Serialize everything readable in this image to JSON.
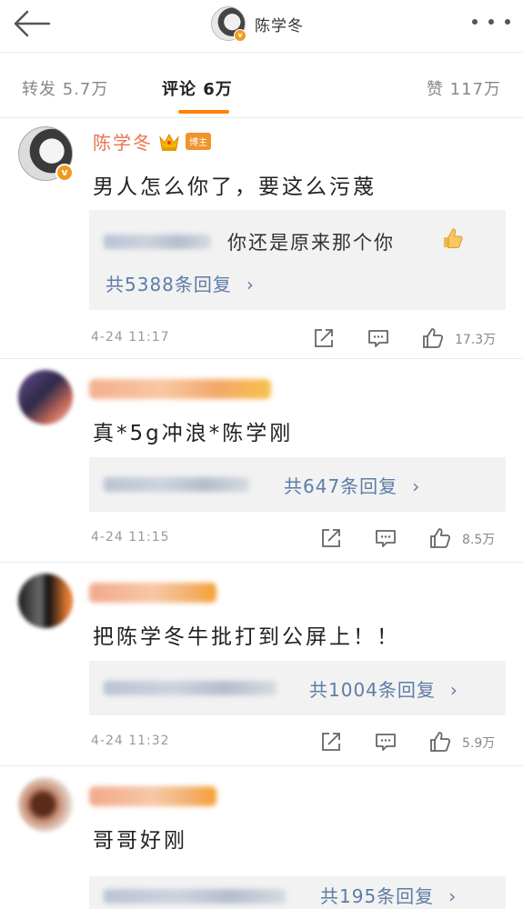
{
  "header": {
    "name": "陈学冬"
  },
  "tabs": {
    "forward": "转发 5.7万",
    "comments": "评论 6万",
    "likes": "赞 117万"
  },
  "comments": [
    {
      "author": "陈学冬",
      "badge": "博主",
      "text": "男人怎么你了，要这么污蔑",
      "reply_preview": "你还是原来那个你",
      "reply_count": "共5388条回复",
      "time": "4-24 11:17",
      "likes": "17.3万"
    },
    {
      "text": "真*5g冲浪*陈学刚",
      "reply_count": "共647条回复",
      "time": "4-24 11:15",
      "likes": "8.5万"
    },
    {
      "text": "把陈学冬牛批打到公屏上！！",
      "reply_count": "共1004条回复",
      "time": "4-24 11:32",
      "likes": "5.9万"
    },
    {
      "text": "哥哥好刚",
      "reply_count": "共195条回复"
    }
  ],
  "icons": {
    "back": "back-arrow-icon",
    "more": "more-dots-icon",
    "verified": "verified-v-icon",
    "crown": "crown-icon",
    "share": "share-icon",
    "comment": "comment-icon",
    "like": "thumbs-up-icon",
    "thumb_emoji": "thumbs-up-emoji"
  },
  "colors": {
    "accent": "#ff8200",
    "author_name": "#eb7350",
    "reply_link": "#5d7ca6",
    "verified": "#f19a1b"
  }
}
